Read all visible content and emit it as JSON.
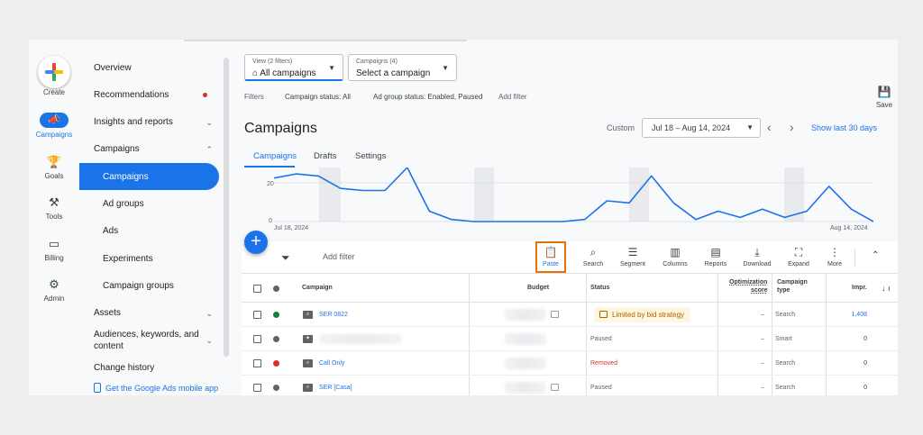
{
  "rail": {
    "create": "Create",
    "items": [
      {
        "label": "Campaigns",
        "icon": "campaigns-icon"
      },
      {
        "label": "Goals",
        "icon": "trophy-icon"
      },
      {
        "label": "Tools",
        "icon": "tools-icon"
      },
      {
        "label": "Billing",
        "icon": "billing-icon"
      },
      {
        "label": "Admin",
        "icon": "gear-icon"
      }
    ]
  },
  "nav": {
    "overview": "Overview",
    "recommendations": "Recommendations",
    "insights": "Insights and reports",
    "campaigns_group": "Campaigns",
    "campaigns": "Campaigns",
    "ad_groups": "Ad groups",
    "ads": "Ads",
    "experiments": "Experiments",
    "campaign_groups": "Campaign groups",
    "assets": "Assets",
    "audiences_line1": "Audiences, keywords, and",
    "audiences_line2": "content",
    "change_history": "Change history",
    "mobile_app": "Get the Google Ads mobile app"
  },
  "view_selector": {
    "small": "View (2 filters)",
    "value": "All campaigns"
  },
  "campaign_selector": {
    "small": "Campaigns (4)",
    "value": "Select a campaign"
  },
  "filters": {
    "label": "Filters",
    "status": "Campaign status: All",
    "ad_group": "Ad group status: Enabled, Paused",
    "add": "Add filter"
  },
  "save_label": "Save",
  "page_title": "Campaigns",
  "date": {
    "custom": "Custom",
    "range": "Jul 18 – Aug 14, 2024",
    "show_last": "Show last 30 days"
  },
  "tabs": [
    "Campaigns",
    "Drafts",
    "Settings"
  ],
  "chart_data": {
    "type": "line",
    "x_start": "Jul 18, 2024",
    "x_end": "Aug 14, 2024",
    "y_ticks": [
      "20",
      "0"
    ],
    "ylim": [
      0,
      30
    ],
    "values": [
      21,
      23,
      22,
      16,
      15,
      15,
      34,
      5,
      1,
      0,
      0,
      0,
      0,
      0,
      1,
      10,
      9,
      22,
      9,
      1,
      5,
      2,
      6,
      2,
      5,
      17,
      6,
      0
    ],
    "color": "#1a73e8"
  },
  "toolbar": {
    "add_filter": "Add filter",
    "tools": [
      {
        "label": "Paste",
        "icon": "paste-icon"
      },
      {
        "label": "Search",
        "icon": "search-icon"
      },
      {
        "label": "Segment",
        "icon": "segment-icon"
      },
      {
        "label": "Columns",
        "icon": "columns-icon"
      },
      {
        "label": "Reports",
        "icon": "reports-icon"
      },
      {
        "label": "Download",
        "icon": "download-icon"
      },
      {
        "label": "Expand",
        "icon": "expand-icon"
      },
      {
        "label": "More",
        "icon": "more-icon"
      }
    ]
  },
  "table": {
    "headers": {
      "campaign": "Campaign",
      "budget": "Budget",
      "status": "Status",
      "opt1": "Optimization",
      "opt2": "score",
      "type1": "Campaign",
      "type2": "type",
      "impr": "Impr."
    },
    "rows": [
      {
        "dot": "#188038",
        "name": "SER 0822",
        "status": "Limited by bid strategy",
        "opt": "–",
        "type": "Search",
        "impr": "1,408"
      },
      {
        "dot": "#5f6368",
        "name": "",
        "status": "Paused",
        "opt": "–",
        "type": "Smart",
        "impr": "0"
      },
      {
        "dot": "#d93025",
        "name": "Call Only",
        "status": "Removed",
        "opt": "–",
        "type": "Search",
        "impr": "0"
      },
      {
        "dot": "#5f6368",
        "name": "SER [Casa]",
        "status": "Paused",
        "opt": "–",
        "type": "Search",
        "impr": "0"
      }
    ]
  }
}
